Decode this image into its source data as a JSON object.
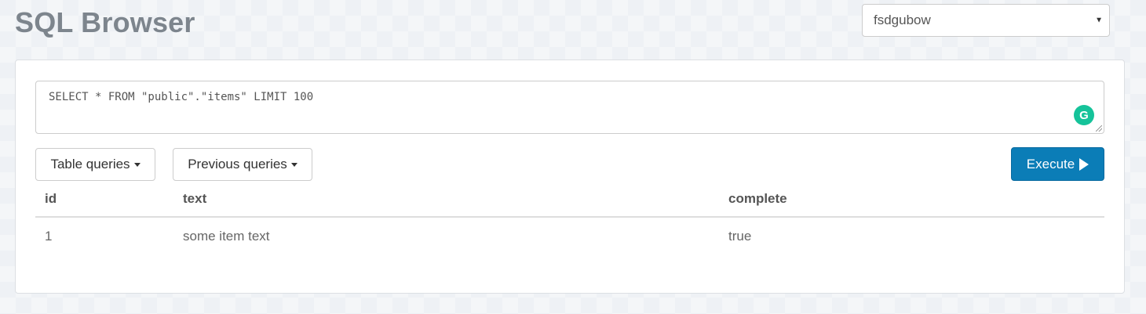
{
  "app": {
    "title": "SQL Browser"
  },
  "database_select": {
    "selected": "fsdgubow"
  },
  "query": {
    "text": "SELECT * FROM \"public\".\"items\" LIMIT 100"
  },
  "grammarly": {
    "glyph": "G",
    "color": "#15c39a"
  },
  "toolbar": {
    "table_queries_label": "Table queries",
    "previous_queries_label": "Previous queries",
    "execute_label": "Execute"
  },
  "results": {
    "columns": [
      "id",
      "text",
      "complete"
    ],
    "rows": [
      [
        "1",
        "some item text",
        "true"
      ]
    ]
  },
  "colors": {
    "accent": "#0b7db7",
    "title": "#7d858d"
  }
}
